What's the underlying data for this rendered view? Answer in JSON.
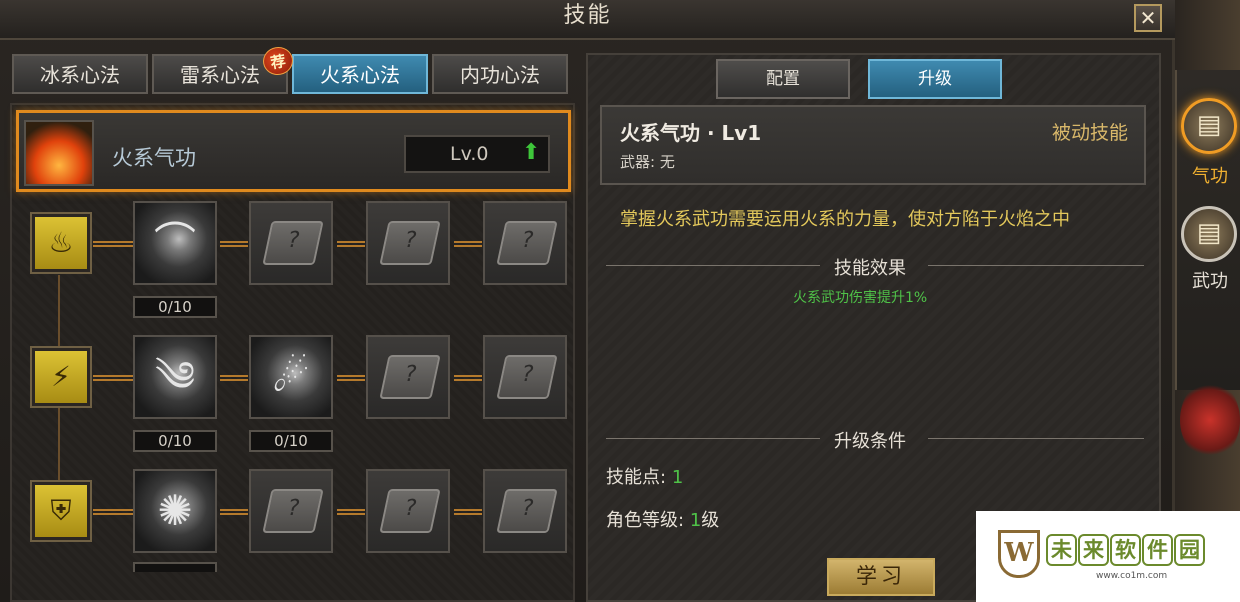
{
  "window": {
    "title": "技能",
    "close_label": "✕"
  },
  "left_tabs": [
    {
      "label": "冰系心法",
      "active": false
    },
    {
      "label": "雷系心法",
      "active": false
    },
    {
      "label": "火系心法",
      "active": true
    },
    {
      "label": "内功心法",
      "active": false
    }
  ],
  "recommend_badge": "荐",
  "skill": {
    "name": "火系气功",
    "level": "Lv.0",
    "upgrade_icon": "⬆"
  },
  "rows": [
    {
      "category_icon": "fire-emblem-icon",
      "slots": [
        {
          "state": "unlocked",
          "icon": "slash-icon",
          "count": "0/10"
        },
        {
          "state": "locked"
        },
        {
          "state": "locked"
        },
        {
          "state": "locked"
        }
      ]
    },
    {
      "category_icon": "claw-emblem-icon",
      "slots": [
        {
          "state": "unlocked",
          "icon": "spirit-icon",
          "count": "0/10"
        },
        {
          "state": "unlocked",
          "icon": "comet-icon",
          "count": "0/10"
        },
        {
          "state": "locked"
        },
        {
          "state": "locked"
        }
      ]
    },
    {
      "category_icon": "shield-emblem-icon",
      "slots": [
        {
          "state": "unlocked",
          "icon": "burst-icon"
        },
        {
          "state": "locked"
        },
        {
          "state": "locked"
        },
        {
          "state": "locked"
        }
      ]
    }
  ],
  "right_tabs": [
    {
      "label": "配置",
      "active": false
    },
    {
      "label": "升级",
      "active": true
    }
  ],
  "detail": {
    "title": "火系气功 · Lv1",
    "type": "被动技能",
    "weapon": "武器: 无",
    "description": "掌握火系武功需要运用火系的力量，使对方陷于火焰之中",
    "effect_heading": "技能效果",
    "effect": "火系武功伤害提升1%",
    "condition_heading": "升级条件",
    "skill_points_label": "技能点:",
    "skill_points_value": "1",
    "role_level_label": "角色等级:",
    "role_level_value": "1",
    "role_level_unit": "级",
    "learn_button": "学习"
  },
  "side_tabs": [
    {
      "label": "气功",
      "icon": "qigong-book-icon",
      "active": true
    },
    {
      "label": "武功",
      "icon": "martial-book-icon",
      "active": false
    }
  ],
  "watermark": {
    "logo_letter": "W",
    "chars": [
      "未",
      "来",
      "软",
      "件",
      "园"
    ],
    "url": "www.co1m.com"
  },
  "colors": {
    "accent_orange": "#e08a1e",
    "tab_active": "#3f8ab0",
    "value_green": "#4fc248",
    "desc_yellow": "#e3c85b"
  }
}
